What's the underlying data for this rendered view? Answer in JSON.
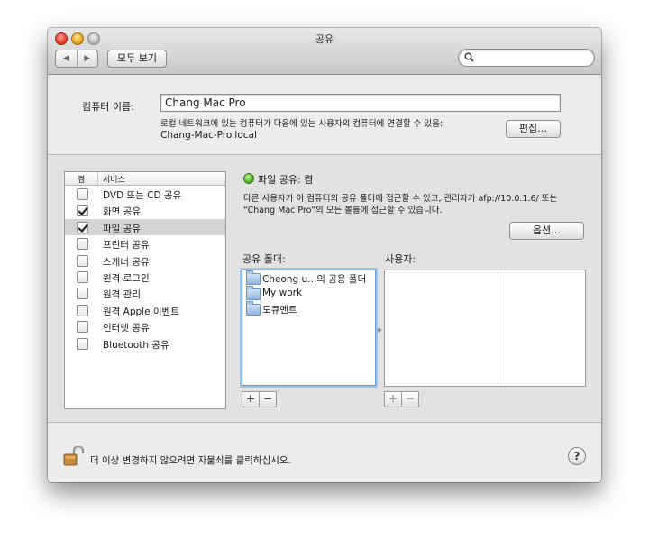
{
  "window": {
    "title": "공유"
  },
  "toolbar": {
    "back_icon": "◀",
    "forward_icon": "▶",
    "show_all_label": "모두 보기",
    "search_placeholder": ""
  },
  "computer": {
    "label": "컴퓨터 이름:",
    "name_value": "Chang Mac Pro",
    "description": "로컬 네트워크에 있는 컴퓨터가 다음에 있는 사용자의 컴퓨터에 연결할 수 있음:",
    "hostname": "Chang-Mac-Pro.local",
    "edit_label": "편집…"
  },
  "services": {
    "header_on": "켬",
    "header_service": "서비스",
    "items": [
      {
        "label": "DVD 또는 CD 공유",
        "checked": false
      },
      {
        "label": "화면 공유",
        "checked": true
      },
      {
        "label": "파일 공유",
        "checked": true,
        "selected": true
      },
      {
        "label": "프린터 공유",
        "checked": false
      },
      {
        "label": "스캐너 공유",
        "checked": false
      },
      {
        "label": "원격 로그인",
        "checked": false
      },
      {
        "label": "원격 관리",
        "checked": false
      },
      {
        "label": "원격 Apple 이벤트",
        "checked": false
      },
      {
        "label": "인터넷 공유",
        "checked": false
      },
      {
        "label": "Bluetooth 공유",
        "checked": false
      }
    ]
  },
  "file_sharing": {
    "status": "파일 공유: 켬",
    "status_color": "#4bb51f",
    "info_line1": "다른 사용자가 이 컴퓨터의 공유 폴더에 접근할 수 있고, 관리자가 afp://10.0.1.6/ 또는",
    "info_line2": "“Chang Mac Pro”의 모든 볼륨에 접근할 수 있습니다.",
    "options_label": "옵션…",
    "folders_label": "공유 폴더:",
    "users_label": "사용자:",
    "folders": [
      "Cheong u...의 공용 폴더",
      "My work",
      "도큐멘트"
    ],
    "add_label": "+",
    "remove_label": "−"
  },
  "footer": {
    "lock_text": "더 이상 변경하지 않으려면 자물쇠를 클릭하십시오.",
    "help_label": "?"
  }
}
